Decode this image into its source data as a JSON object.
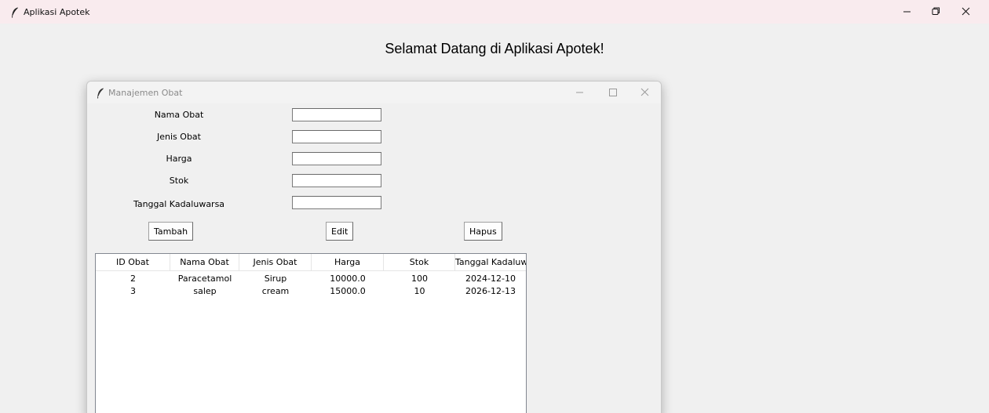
{
  "main_window": {
    "title": "Aplikasi Apotek",
    "welcome_text": "Selamat Datang di Aplikasi Apotek!",
    "icons": {
      "app": "feather-icon",
      "minimize": "minimize-icon",
      "restore": "restore-icon",
      "close": "close-icon"
    }
  },
  "sub_window": {
    "title": "Manajemen Obat",
    "form": {
      "nama_label": "Nama Obat",
      "jenis_label": "Jenis Obat",
      "harga_label": "Harga",
      "stok_label": "Stok",
      "tanggal_label": "Tanggal Kadaluwarsa",
      "nama_value": "",
      "jenis_value": "",
      "harga_value": "",
      "stok_value": "",
      "tanggal_value": ""
    },
    "buttons": {
      "tambah": "Tambah",
      "edit": "Edit",
      "hapus": "Hapus"
    },
    "table": {
      "columns": [
        "ID Obat",
        "Nama Obat",
        "Jenis Obat",
        "Harga",
        "Stok",
        "Tanggal Kadaluwa"
      ],
      "rows": [
        [
          "2",
          "Paracetamol",
          "Sirup",
          "10000.0",
          "100",
          "2024-12-10"
        ],
        [
          "3",
          "salep",
          "cream",
          "15000.0",
          "10",
          "2026-12-13"
        ]
      ]
    }
  }
}
